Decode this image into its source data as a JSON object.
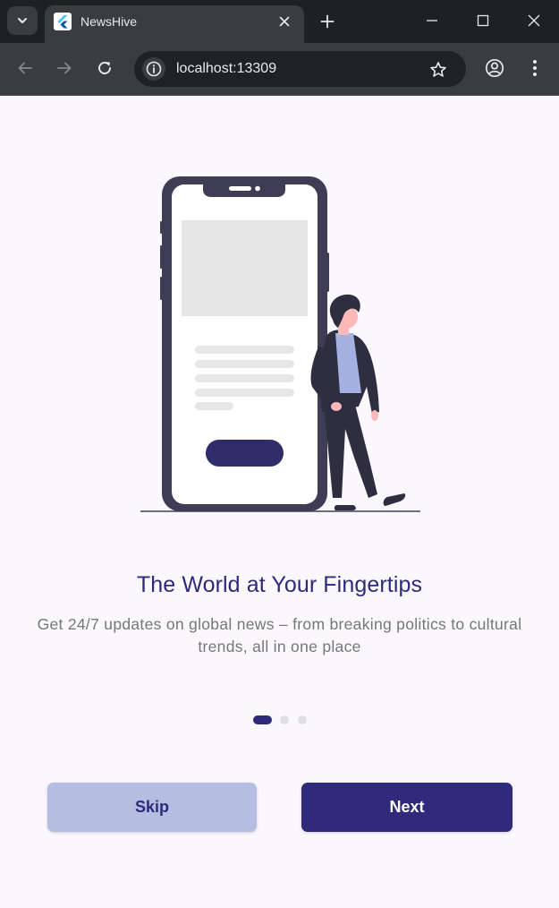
{
  "browser": {
    "tab_title": "NewsHive",
    "url": "localhost:13309"
  },
  "icons": {
    "tab_search": "chevron-down-icon",
    "favicon": "flutter-icon",
    "tab_close": "close-icon",
    "new_tab": "plus-icon",
    "minimize": "minimize-icon",
    "maximize": "maximize-icon",
    "window_close": "close-icon",
    "back": "arrow-left-icon",
    "forward": "arrow-right-icon",
    "reload": "reload-icon",
    "site_info": "site-info-icon",
    "bookmark": "star-icon",
    "profile": "profile-icon",
    "menu": "more-vertical-icon"
  },
  "onboarding": {
    "headline": "The World at Your Fingertips",
    "description": "Get 24/7 updates on global news – from breaking politics to cultural trends, all in one place",
    "current_page": 1,
    "page_count": 3,
    "skip_label": "Skip",
    "next_label": "Next"
  },
  "colors": {
    "primary": "#2f2a7c",
    "skip_button": "#b6bde2",
    "headline": "#2d2a7a",
    "body_text": "#767676",
    "background": "#fbf8fd",
    "indicator_inactive": "#e0dfe4"
  }
}
